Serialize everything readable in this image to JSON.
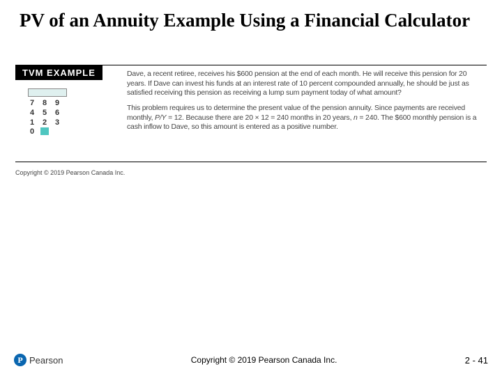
{
  "title": "PV of an Annuity Example Using a Financial Calculator",
  "tvm_label": "TVM EXAMPLE",
  "calc": {
    "rows": [
      [
        "7",
        "8",
        "9"
      ],
      [
        "4",
        "5",
        "6"
      ],
      [
        "1",
        "2",
        "3"
      ]
    ],
    "zero": "0"
  },
  "problem": {
    "p1_a": "Dave, a recent retiree, receives his $600 pension at the end of each month. He will receive this pension for 20 years. If Dave can invest his funds at an interest rate of 10 percent compounded annually, he should be just as satisfied receiving this pension as receiving a lump sum payment today of what amount?",
    "p2_a": "This problem requires us to determine the present value of the pension annuity. Since payments are received monthly, ",
    "p2_py": "P/Y",
    "p2_b": " = 12. Because there are 20 × 12 = 240 months in 20 years, ",
    "p2_n": "n",
    "p2_c": " = 240. The $600 monthly pension is a cash inflow to Dave, so this amount is entered as a positive number."
  },
  "inner_copy": "Copyright © 2019 Pearson Canada Inc.",
  "logo": {
    "badge": "P",
    "text": "Pearson"
  },
  "footer_copy": "Copyright © 2019 Pearson Canada Inc.",
  "slide_num": "2 - 41"
}
